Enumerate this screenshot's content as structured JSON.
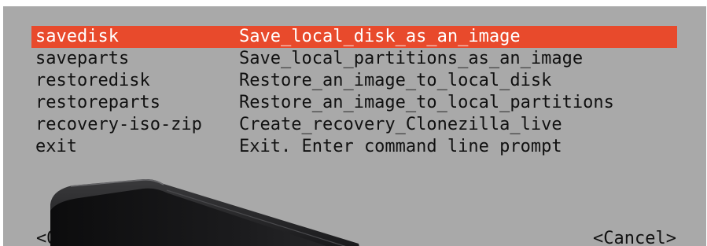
{
  "menu": {
    "items": [
      {
        "tag": "savedisk",
        "desc": "Save_local_disk_as_an_image",
        "selected": true
      },
      {
        "tag": "saveparts",
        "desc": "Save_local_partitions_as_an_image",
        "selected": false
      },
      {
        "tag": "restoredisk",
        "desc": "Restore_an_image_to_local_disk",
        "selected": false
      },
      {
        "tag": "restoreparts",
        "desc": "Restore_an_image_to_local_partitions",
        "selected": false
      },
      {
        "tag": "recovery-iso-zip",
        "desc": "Create_recovery_Clonezilla_live",
        "selected": false
      },
      {
        "tag": "exit",
        "desc": "Exit. Enter command line prompt",
        "selected": false
      }
    ]
  },
  "buttons": {
    "ok_label": "<Ok",
    "cancel_label": "<Cancel>"
  },
  "colors": {
    "screen_background": "#a9a9a9",
    "highlight": "#e84a2c",
    "text": "#111111",
    "highlight_text": "#ffffff"
  },
  "icons": {
    "overlay": "external-hard-drive-icon"
  }
}
